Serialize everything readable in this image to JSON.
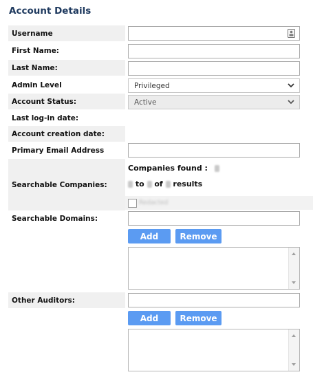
{
  "page_title": "Account Details",
  "fields": {
    "username": {
      "label": "Username",
      "value": ""
    },
    "first_name": {
      "label": "First Name:",
      "value": ""
    },
    "last_name": {
      "label": "Last Name:",
      "value": ""
    },
    "admin_level": {
      "label": "Admin Level",
      "value": "Privileged"
    },
    "account_status": {
      "label": "Account Status:",
      "value": "Active"
    },
    "last_login": {
      "label": "Last log-in date:",
      "value": ""
    },
    "creation_date": {
      "label": "Account creation date:",
      "value": ""
    },
    "primary_email": {
      "label": "Primary Email Address",
      "value": ""
    },
    "searchable_companies": {
      "label": "Searchable Companies:",
      "found_label": "Companies found :",
      "to_word": "to",
      "of_word": "of",
      "results_word": "results",
      "checkbox_label": "Redacted"
    },
    "searchable_domains": {
      "label": "Searchable Domains:",
      "value": ""
    },
    "other_auditors": {
      "label": "Other Auditors:",
      "value": ""
    }
  },
  "buttons": {
    "add": "Add",
    "remove": "Remove"
  },
  "icons": {
    "username_field": "contact-card-icon",
    "select_arrow": "chevron-down-icon",
    "scroll_up": "scroll-up-arrow-icon",
    "scroll_down": "scroll-down-arrow-icon"
  },
  "colors": {
    "title": "#1f3a5f",
    "button": "#5b9bf2",
    "label_shade": "#f0f0f0",
    "disabled_select": "#ececec"
  }
}
